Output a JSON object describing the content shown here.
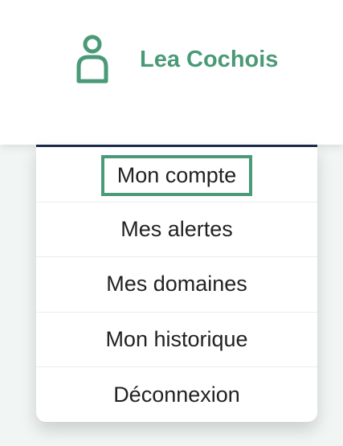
{
  "header": {
    "user": {
      "name": "Lea Cochois",
      "icon": "user-icon"
    }
  },
  "menu": {
    "items": [
      {
        "label": "Mon compte",
        "focused": true
      },
      {
        "label": "Mes alertes"
      },
      {
        "label": "Mes domaines"
      },
      {
        "label": "Mon historique"
      },
      {
        "label": "Déconnexion"
      }
    ]
  },
  "colors": {
    "accent": "#4a9a77",
    "menu_border_top": "#1c2a4a",
    "page_background": "#f1f6f4"
  }
}
